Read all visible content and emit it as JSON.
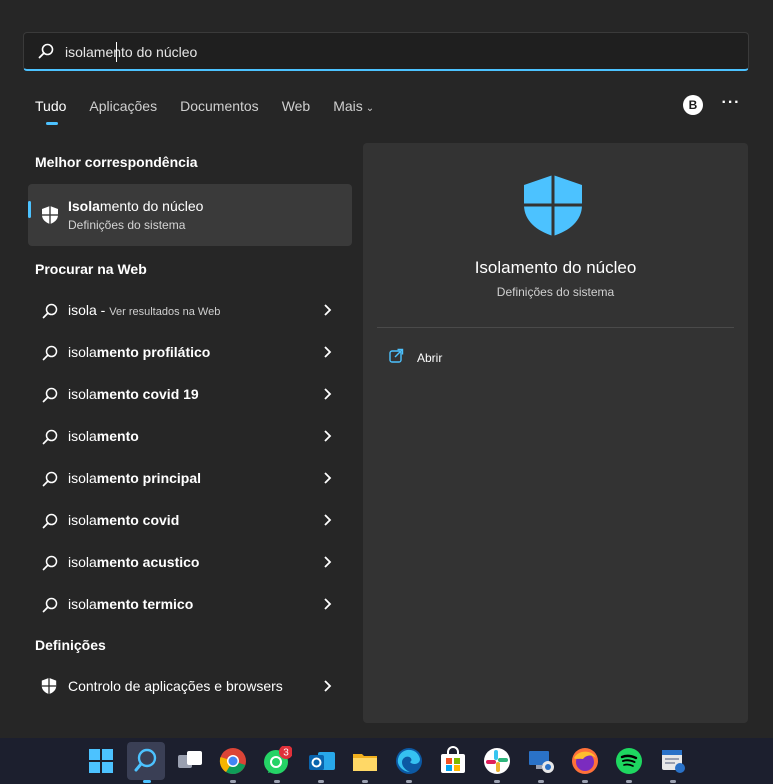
{
  "search": {
    "typed": "isola",
    "rest": "mento do núcleo"
  },
  "tabs": [
    {
      "label": "Tudo"
    },
    {
      "label": "Aplicações"
    },
    {
      "label": "Documentos"
    },
    {
      "label": "Web"
    },
    {
      "label": "Mais"
    }
  ],
  "account": {
    "initial": "B"
  },
  "sections": {
    "best_match": "Melhor correspondência",
    "web": "Procurar na Web",
    "settings": "Definições"
  },
  "best_match": {
    "title_bold": "Isola",
    "title_rest": "mento do núcleo",
    "subtitle": "Definições do sistema"
  },
  "web_results": [
    {
      "bold": "isola",
      "rest": " - ",
      "sub": "Ver resultados na Web"
    },
    {
      "bold": "isola",
      "rest": "mento profilático"
    },
    {
      "bold": "isola",
      "rest": "mento covid 19"
    },
    {
      "bold": "isola",
      "rest": "mento"
    },
    {
      "bold": "isola",
      "rest": "mento principal"
    },
    {
      "bold": "isola",
      "rest": "mento covid"
    },
    {
      "bold": "isola",
      "rest": "mento acustico"
    },
    {
      "bold": "isola",
      "rest": "mento termico"
    }
  ],
  "settings_result": {
    "label": "Controlo de aplicações e browsers"
  },
  "detail": {
    "title": "Isolamento do núcleo",
    "subtitle": "Definições do sistema",
    "open_label": "Abrir"
  },
  "taskbar": {
    "whatsapp_badge": "3"
  },
  "colors": {
    "accent": "#4cc2ff",
    "panel": "#262626",
    "selected": "#3a3a3a",
    "detail_bg": "#333333"
  }
}
